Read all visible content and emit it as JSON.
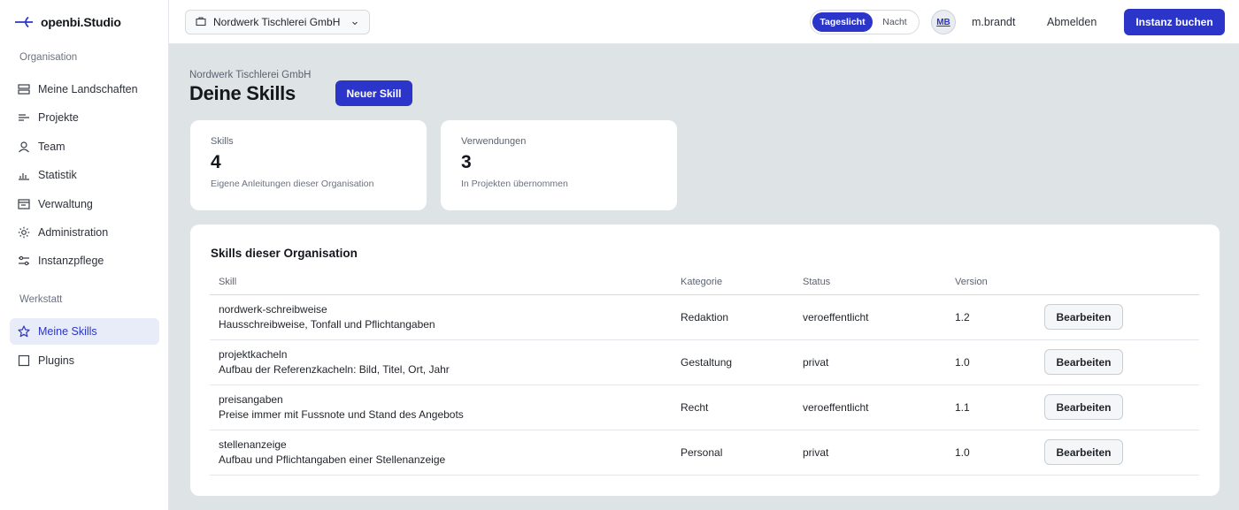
{
  "app": {
    "name": "openbi.Studio"
  },
  "sidebar": {
    "section1": "Organisation",
    "section2": "Werkstatt",
    "items": [
      {
        "label": "Meine Landschaften",
        "icon": "layers-icon"
      },
      {
        "label": "Projekte",
        "icon": "list-icon"
      },
      {
        "label": "Team",
        "icon": "user-icon"
      },
      {
        "label": "Statistik",
        "icon": "bar-chart-icon"
      },
      {
        "label": "Verwaltung",
        "icon": "window-icon"
      },
      {
        "label": "Administration",
        "icon": "gear-icon"
      },
      {
        "label": "Instanzpflege",
        "icon": "sliders-icon"
      },
      {
        "label": "Meine Skills",
        "icon": "star-icon",
        "active": true
      },
      {
        "label": "Plugins",
        "icon": "square-icon"
      }
    ]
  },
  "topbar": {
    "org_select": "Nordwerk Tischlerei GmbH",
    "theme_day": "Tageslicht",
    "theme_night": "Nacht",
    "avatar": "MB",
    "username": "m.brandt",
    "logout": "Abmelden",
    "book_instance": "Instanz buchen"
  },
  "main": {
    "org_name": "Nordwerk Tischlerei GmbH",
    "title": "Deine Skills",
    "new_skill": "Neuer Skill",
    "stats": [
      {
        "label": "Skills",
        "value": "4",
        "desc": "Eigene Anleitungen dieser Organisation"
      },
      {
        "label": "Verwendungen",
        "value": "3",
        "desc": "In Projekten übernommen"
      }
    ],
    "table": {
      "title": "Skills dieser Organisation",
      "headers": [
        "Skill",
        "Kategorie",
        "Status",
        "Version"
      ],
      "edit_label": "Bearbeiten",
      "rows": [
        {
          "name": "nordwerk-schreibweise",
          "desc": "Hausschreibweise, Tonfall und Pflichtangaben",
          "category": "Redaktion",
          "status": "veroeffentlicht",
          "version": "1.2"
        },
        {
          "name": "projektkacheln",
          "desc": "Aufbau der Referenzkacheln: Bild, Titel, Ort, Jahr",
          "category": "Gestaltung",
          "status": "privat",
          "version": "1.0"
        },
        {
          "name": "preisangaben",
          "desc": "Preise immer mit Fussnote und Stand des Angebots",
          "category": "Recht",
          "status": "veroeffentlicht",
          "version": "1.1"
        },
        {
          "name": "stellenanzeige",
          "desc": "Aufbau und Pflichtangaben einer Stellenanzeige",
          "category": "Personal",
          "status": "privat",
          "version": "1.0"
        }
      ]
    }
  },
  "colors": {
    "accent": "#2b35c9",
    "background": "#dee3e6"
  }
}
